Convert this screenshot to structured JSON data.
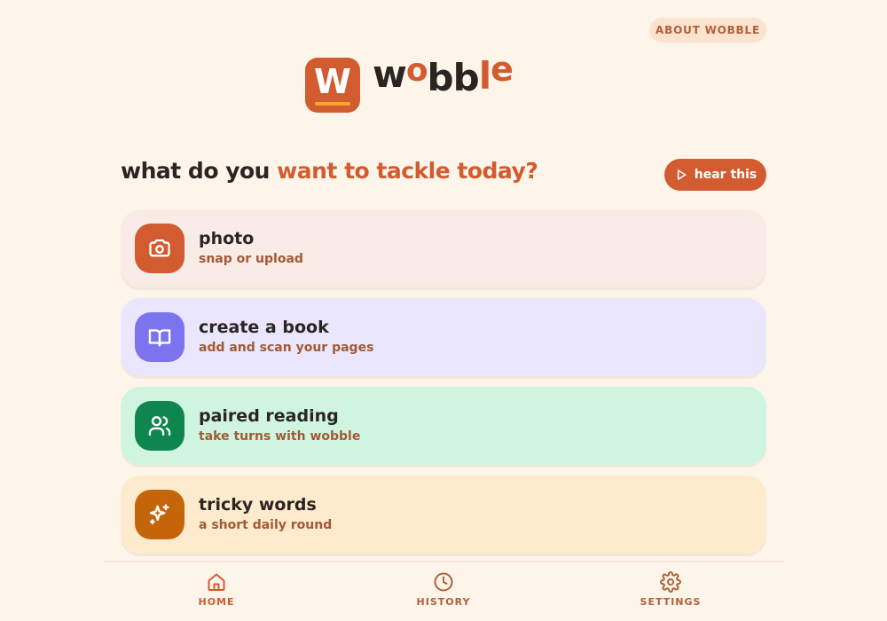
{
  "header": {
    "about_label": "ABOUT WOBBLE",
    "logo_letter": "W",
    "wordmark": [
      "w",
      "o",
      "b",
      "b",
      "l",
      "e"
    ]
  },
  "main": {
    "heading_plain": "what do you ",
    "heading_accent": "want to tackle today?",
    "hear_label": "hear this",
    "cards": [
      {
        "title": "photo",
        "subtitle": "snap or upload",
        "icon": "camera-icon",
        "bg": "#f9ebe5",
        "icon_bg": "#d25b2f"
      },
      {
        "title": "create a book",
        "subtitle": "add and scan your pages",
        "icon": "book-icon",
        "bg": "#e9e6fe",
        "icon_bg": "#7b74ee"
      },
      {
        "title": "paired reading",
        "subtitle": "take turns with wobble",
        "icon": "users-icon",
        "bg": "#cff5e1",
        "icon_bg": "#10864f"
      },
      {
        "title": "tricky words",
        "subtitle": "a short daily round",
        "icon": "sparkles-icon",
        "bg": "#feebcd",
        "icon_bg": "#c5650a"
      }
    ]
  },
  "nav": {
    "items": [
      {
        "label": "HOME",
        "icon": "home-icon",
        "active": true
      },
      {
        "label": "HISTORY",
        "icon": "clock-icon",
        "active": false
      },
      {
        "label": "SETTINGS",
        "icon": "gear-icon",
        "active": false
      }
    ]
  },
  "colors": {
    "background": "#fef5ea",
    "accent": "#d25b2f",
    "text": "#2b2522",
    "subtext": "#a25a35",
    "nav_active": "#d25b2f",
    "nav_inactive": "#b0613a"
  }
}
